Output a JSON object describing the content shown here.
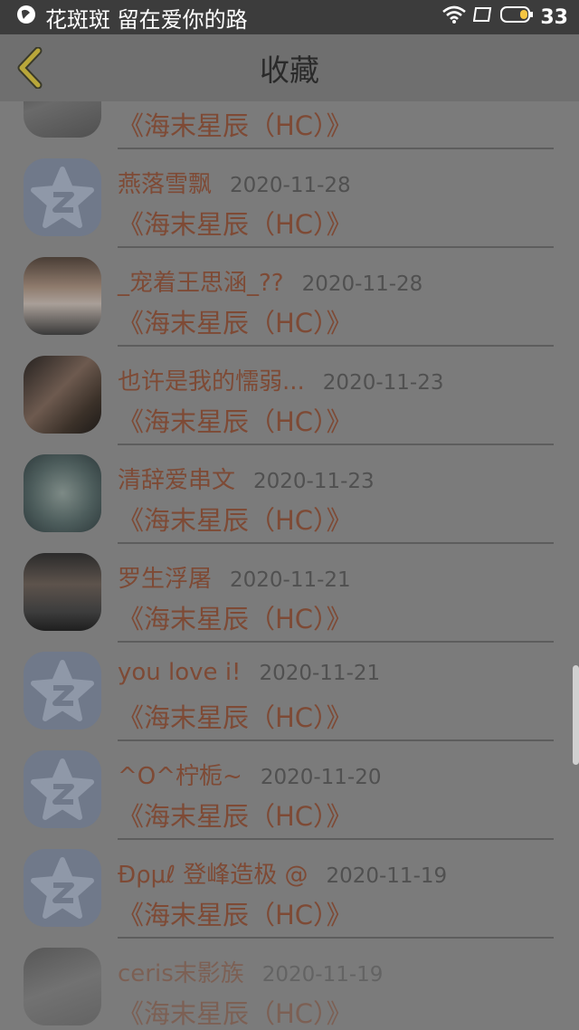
{
  "status_bar": {
    "notification_text": "花斑斑 留在爱你的路",
    "battery_level": "33"
  },
  "nav": {
    "title": "收藏"
  },
  "items": [
    {
      "user": "",
      "date": "",
      "title": "《海末星辰（HC）》",
      "avatar": "photo-ink"
    },
    {
      "user": "燕落雪飘",
      "date": "2020-11-28",
      "title": "《海末星辰（HC）》",
      "avatar": "default"
    },
    {
      "user": "_宠着王思涵_??",
      "date": "2020-11-28",
      "title": "《海末星辰（HC）》",
      "avatar": "photo-girl"
    },
    {
      "user": "也许是我的懦弱...",
      "date": "2020-11-23",
      "title": "《海末星辰（HC）》",
      "avatar": "photo-kiss"
    },
    {
      "user": "清辞爱串文",
      "date": "2020-11-23",
      "title": "《海末星辰（HC）》",
      "avatar": "photo-anime"
    },
    {
      "user": "罗生浮屠",
      "date": "2020-11-21",
      "title": "《海末星辰（HC）》",
      "avatar": "photo-man"
    },
    {
      "user": "you love i!",
      "date": "2020-11-21",
      "title": "《海末星辰（HC）》",
      "avatar": "default"
    },
    {
      "user": "^O^柠栀~",
      "date": "2020-11-20",
      "title": "《海末星辰（HC）》",
      "avatar": "default"
    },
    {
      "user": "Ɖρμℓ 登峰造极 @",
      "date": "2020-11-19",
      "title": "《海末星辰（HC）》",
      "avatar": "default"
    },
    {
      "user": "ceris末影族",
      "date": "2020-11-19",
      "title": "《海末星辰（HC）》",
      "avatar": "photo-ink"
    }
  ]
}
